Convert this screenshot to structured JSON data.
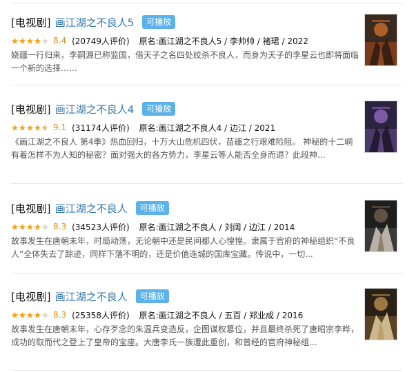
{
  "items": [
    {
      "category": "[电视剧]",
      "title": "画江湖之不良人5",
      "badge": "可播放",
      "rating_stars": 4.0,
      "score": "8.4",
      "votes": "(20749人评价)",
      "subtitle": "原名:画江湖之不良人5 / 李帅帅 / 褚珺 / 2022",
      "description": "娆疆一行归来，李嗣源已称监国，借天子之名四处绞杀不良人，而身为天子的李星云也即将面临一个新的选择……",
      "poster_colors": [
        "#3a2a1f",
        "#c46a2b",
        "#7a3b1c",
        "#2a1a12"
      ]
    },
    {
      "category": "[电视剧]",
      "title": "画江湖之不良人4",
      "badge": "可播放",
      "rating_stars": 4.5,
      "score": "9.1",
      "votes": "(31174人评价)",
      "subtitle": "原名:画江湖之不良人4 / 边江 / 2021",
      "description": "《画江湖之不良人 第4季》热血回归，十万大山危机四伏，苗疆之行艰难险阻。 神秘的十二峒有着怎样不为人知的秘密？面对强大的各方势力，李星云等人能否全身而退？此段神...",
      "poster_colors": [
        "#2c2340",
        "#8b63b5",
        "#4a3a6a",
        "#1a1426"
      ]
    },
    {
      "category": "[电视剧]",
      "title": "画江湖之不良人",
      "badge": "可播放",
      "rating_stars": 4.0,
      "score": "8.3",
      "votes": "(34523人评价)",
      "subtitle": "原名:画江湖之不良人 / 刘阔 / 边江 / 2014",
      "description": "故事发生在唐朝末年，时局动荡，无论朝中还是民间都人心惶惶。隶属于官府的神秘组织“不良人”全体失去了踪迹，同样下落不明的，还是价值连城的国库宝藏。传说中，一切...",
      "poster_colors": [
        "#1e1e1e",
        "#6b5a4a",
        "#3a3a3a",
        "#d9cfc0"
      ]
    },
    {
      "category": "[电视剧]",
      "title": "画江湖之不良人",
      "badge": "可播放",
      "rating_stars": 4.0,
      "score": "8.3",
      "votes": "(25358人评价)",
      "subtitle": "原名:画江湖之不良人 / 五百 / 郑业成 / 2016",
      "description": "故事发生在唐朝末年，心存歹念的朱温兵变造反，企图谋权篡位，并且最终杀死了唐昭宗李晔，成功的取而代之登上了皇帝的宝座。大唐李氏一族遭此重创，和曾经的官府神秘组...",
      "poster_colors": [
        "#2a2016",
        "#b08a4a",
        "#5a4226",
        "#e8d6a8"
      ]
    }
  ],
  "colors": {
    "title_link": "#3377aa",
    "badge_bg": "#5cb2e8",
    "star": "#f6a623",
    "star_empty": "#d8d8d8",
    "score": "#e09015"
  }
}
